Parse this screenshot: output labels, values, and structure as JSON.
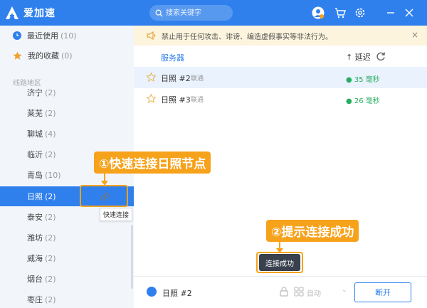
{
  "app": {
    "title": "爱加速"
  },
  "search": {
    "placeholder": "搜索关键字"
  },
  "sidebar": {
    "recent": {
      "label": "最近使用",
      "count": "(10)"
    },
    "favorites": {
      "label": "我的收藏",
      "count": "(0)"
    },
    "section_title": "线路地区",
    "regions": [
      {
        "name": "济宁",
        "count": "(2)"
      },
      {
        "name": "莱芜",
        "count": "(2)"
      },
      {
        "name": "聊城",
        "count": "(4)"
      },
      {
        "name": "临沂",
        "count": "(2)"
      },
      {
        "name": "青岛",
        "count": "(10)"
      },
      {
        "name": "日照",
        "count": "(2)"
      },
      {
        "name": "泰安",
        "count": "(2)"
      },
      {
        "name": "潍坊",
        "count": "(2)"
      },
      {
        "name": "威海",
        "count": "(2)"
      },
      {
        "name": "烟台",
        "count": "(2)"
      },
      {
        "name": "枣庄",
        "count": "(2)"
      }
    ],
    "selected_region": "日照"
  },
  "notice": {
    "text": "禁止用于任何攻击、诽谤、编造虚假事实等非法行为。",
    "close": "×"
  },
  "server_list": {
    "col_server": "服务器",
    "col_latency": "延迟",
    "rows": [
      {
        "name": "日照 #2",
        "isp": "联通",
        "latency": "35 毫秒"
      },
      {
        "name": "日照 #3",
        "isp": "联通",
        "latency": "26 毫秒"
      }
    ]
  },
  "quick_connect": {
    "tooltip": "快速连接"
  },
  "bottom_bar": {
    "current_server": "日照 #2",
    "mode_label": "自动",
    "disconnect_label": "断开"
  },
  "toast": {
    "text": "连接成功"
  },
  "annotations": {
    "step1": "①快速连接日照节点",
    "step2": "②提示连接成功"
  },
  "colors": {
    "accent": "#2f80ed",
    "annotation": "#f7a21b",
    "latency_good": "#27ae60",
    "notice_bg": "#fdf4dd"
  }
}
